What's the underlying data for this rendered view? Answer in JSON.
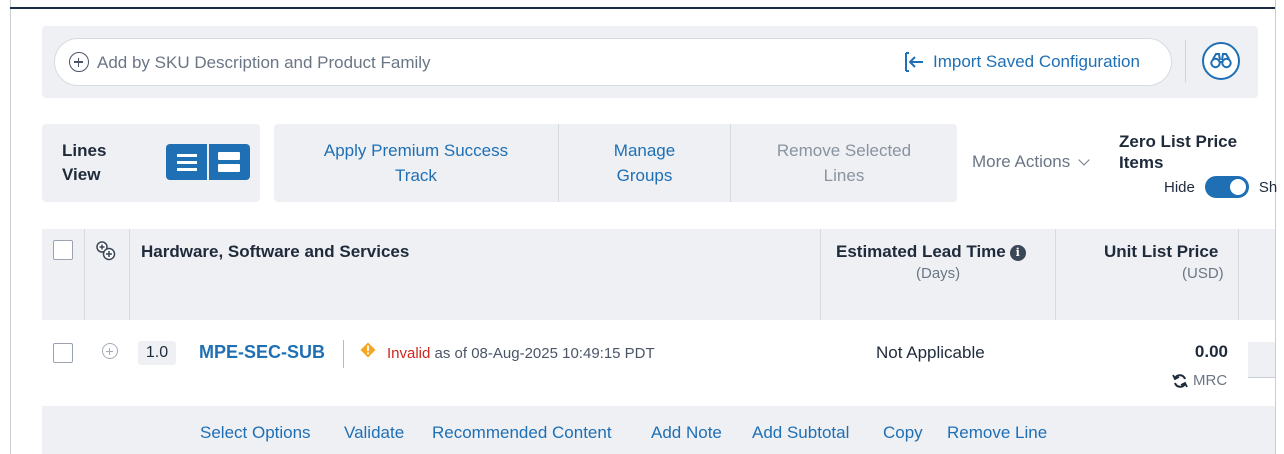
{
  "search": {
    "placeholder": "Add by SKU Description and Product Family",
    "import_label": "Import Saved Configuration"
  },
  "toolbar": {
    "lines_view_label_1": "Lines",
    "lines_view_label_2": "View",
    "apply_premium_1": "Apply Premium Success",
    "apply_premium_2": "Track",
    "manage_groups_1": "Manage",
    "manage_groups_2": "Groups",
    "remove_selected_1": "Remove Selected",
    "remove_selected_2": "Lines",
    "more_actions": "More Actions",
    "zero_list_title_1": "Zero List Price",
    "zero_list_title_2": "Items",
    "zero_hide": "Hide",
    "zero_show": "Sh",
    "zero_toggle_on": true
  },
  "table": {
    "headers": {
      "product": "Hardware, Software and Services",
      "lead_time": "Estimated Lead Time",
      "lead_time_sub": "(Days)",
      "unit_price": "Unit List Price",
      "unit_price_sub": "(USD)"
    },
    "rows": [
      {
        "line": "1.0",
        "sku": "MPE-SEC-SUB",
        "status_label": "Invalid",
        "status_suffix": "as of 08-Aug-2025 10:49:15 PDT",
        "lead_time": "Not Applicable",
        "unit_price": "0.00",
        "billing": "MRC"
      }
    ],
    "row_actions": [
      "Select Options",
      "Validate",
      "Recommended Content",
      "Add Note",
      "Add Subtotal",
      "Copy",
      "Remove Line"
    ]
  },
  "colors": {
    "accent": "#1f6fb5",
    "invalid": "#d0271d",
    "warning": "#f5a623",
    "band": "#eef0f3"
  }
}
